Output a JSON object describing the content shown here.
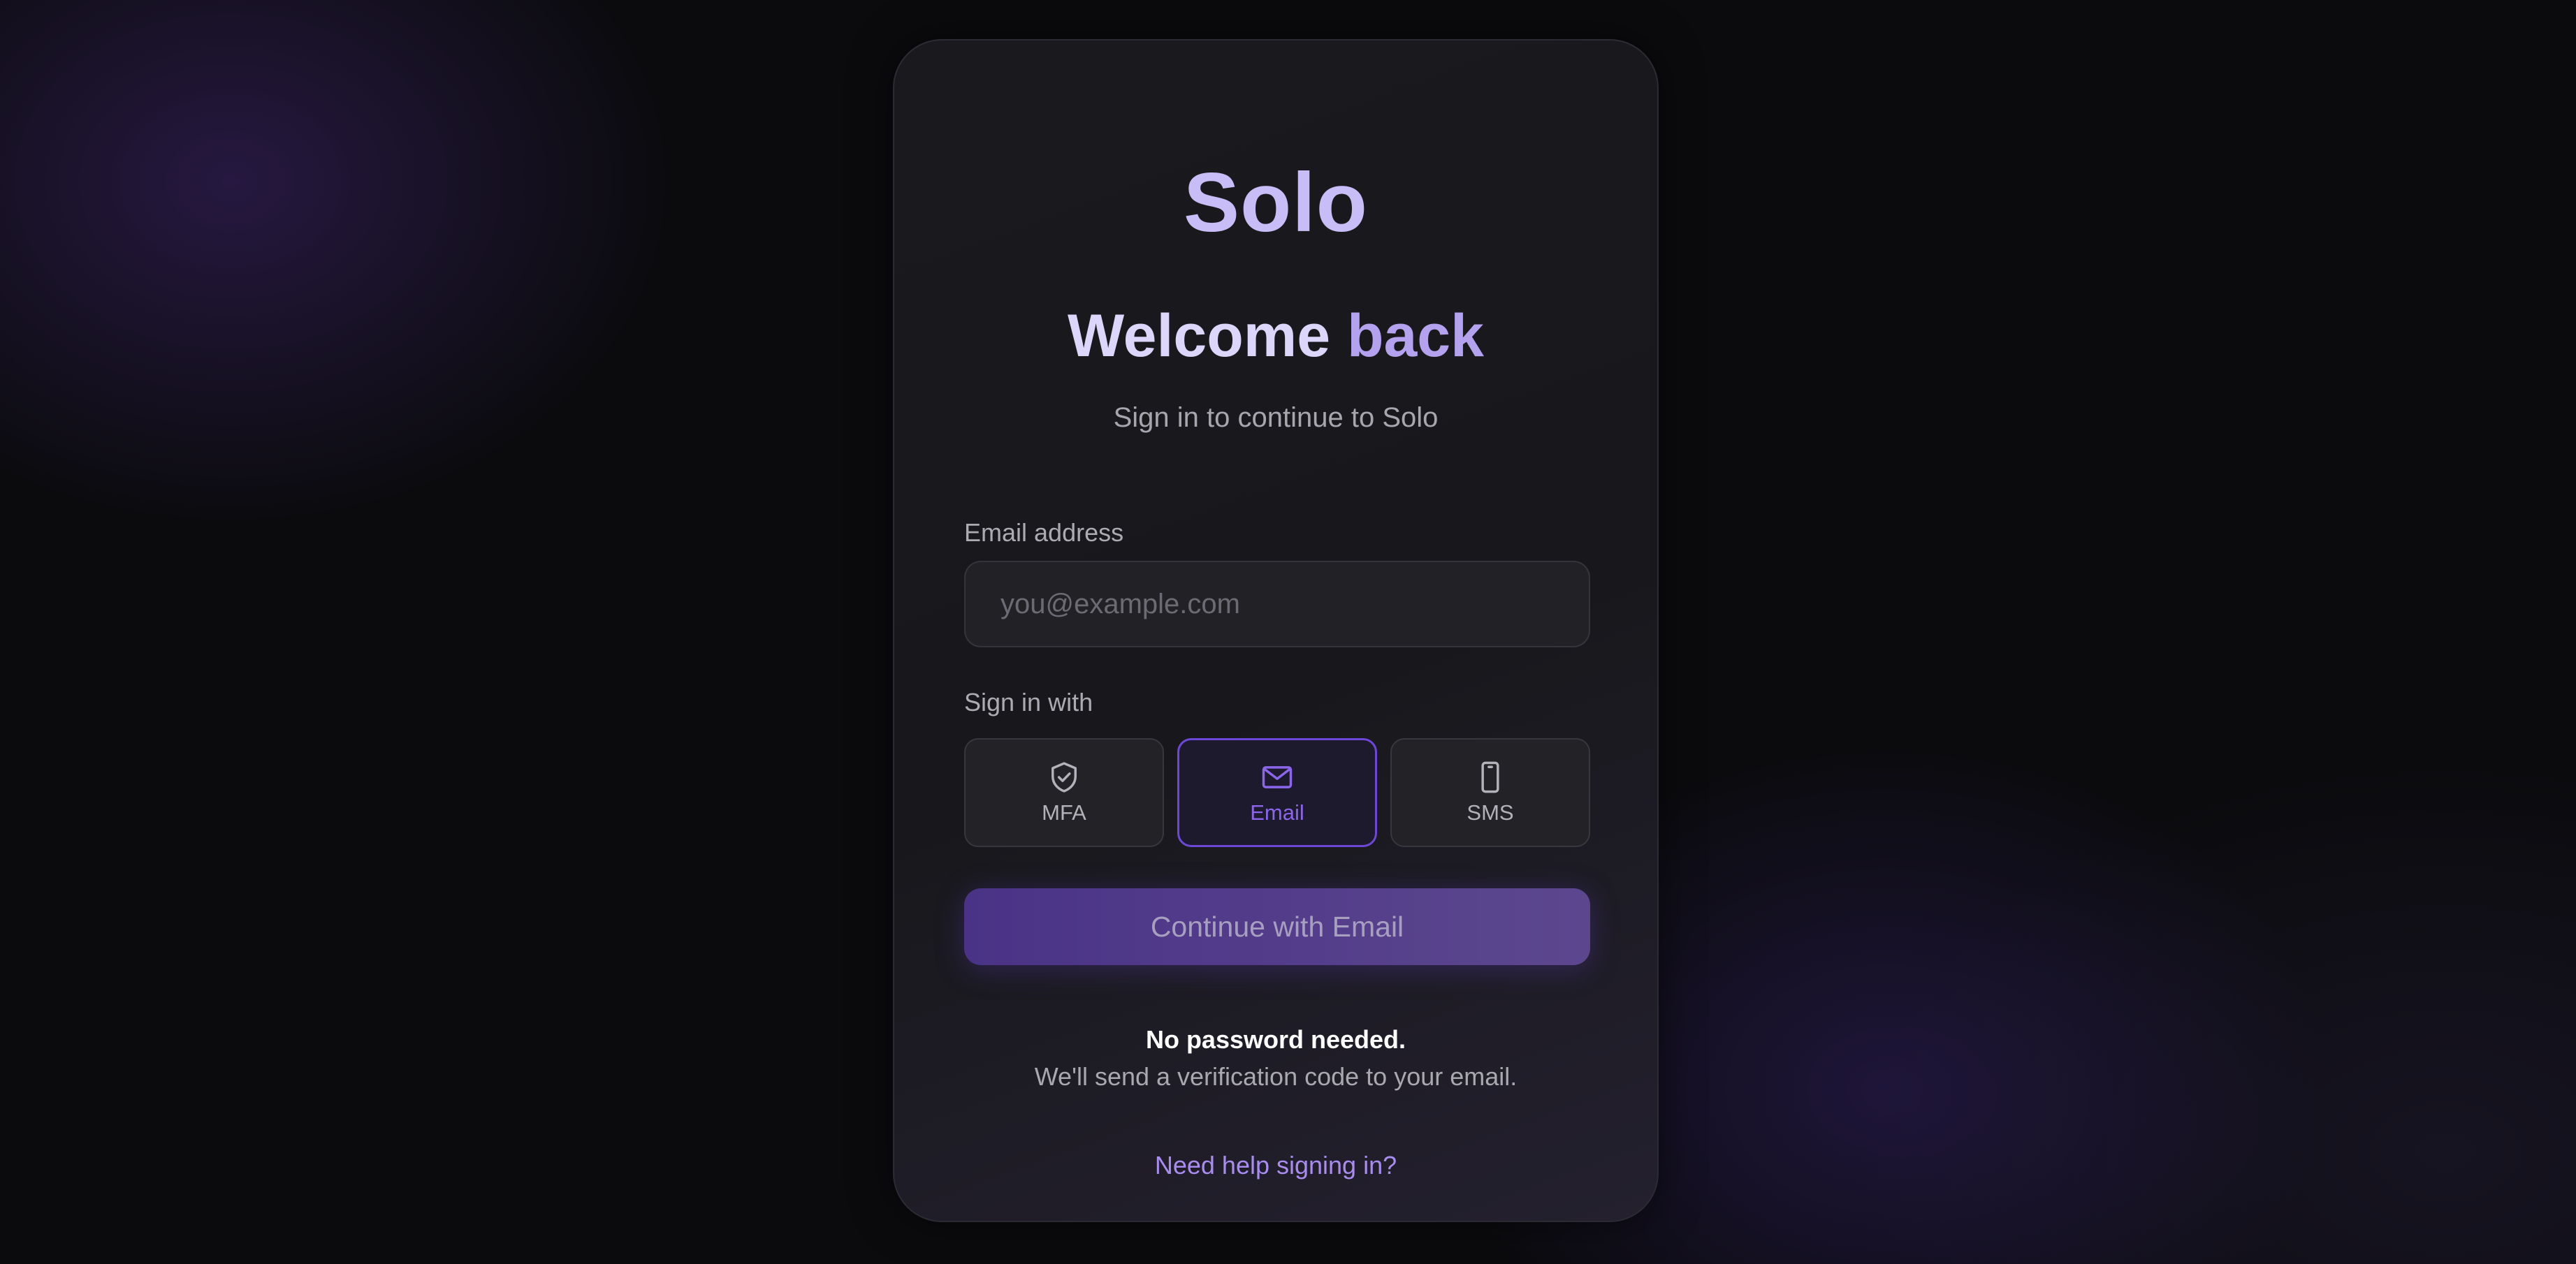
{
  "app": {
    "logo_text": "Solo"
  },
  "header": {
    "title_part1": "Welcome",
    "title_part2": "back",
    "subtitle": "Sign in to continue to Solo"
  },
  "form": {
    "email_label": "Email address",
    "email_placeholder": "you@example.com",
    "email_value": "",
    "method_label": "Sign in with",
    "methods": [
      {
        "label": "MFA",
        "icon": "shield-check-icon",
        "selected": false
      },
      {
        "label": "Email",
        "icon": "envelope-icon",
        "selected": true
      },
      {
        "label": "SMS",
        "icon": "smartphone-icon",
        "selected": false
      }
    ],
    "submit_label": "Continue with Email"
  },
  "note": {
    "strong": "No password needed.",
    "text": "We'll send a verification code to your email."
  },
  "help": {
    "link_text": "Need help signing in?"
  },
  "colors": {
    "background": "#0b0b0e",
    "card": "#1a1a1e",
    "accent": "#8b66ec",
    "logo": "#c8bdf6",
    "link": "#a88cf0",
    "button_start": "#4a3386",
    "button_end": "#5c478f"
  }
}
